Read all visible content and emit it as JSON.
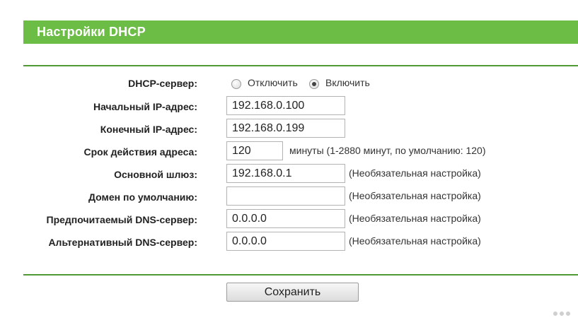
{
  "header": {
    "title": "Настройки DHCP"
  },
  "form": {
    "dhcp_server": {
      "label": "DHCP-сервер:",
      "options": [
        {
          "label": "Отключить",
          "checked": false
        },
        {
          "label": "Включить",
          "checked": true
        }
      ]
    },
    "start_ip": {
      "label": "Начальный IP-адрес:",
      "value": "192.168.0.100"
    },
    "end_ip": {
      "label": "Конечный IP-адрес:",
      "value": "192.168.0.199"
    },
    "lease_time": {
      "label": "Срок действия адреса:",
      "value": "120",
      "hint": "минуты (1-2880 минут, по умолчанию: 120)"
    },
    "gateway": {
      "label": "Основной шлюз:",
      "value": "192.168.0.1",
      "hint": "(Необязательная настройка)"
    },
    "default_domain": {
      "label": "Домен по умолчанию:",
      "value": "",
      "hint": "(Необязательная настройка)"
    },
    "primary_dns": {
      "label": "Предпочитаемый DNS-сервер:",
      "value": "0.0.0.0",
      "hint": "(Необязательная настройка)"
    },
    "secondary_dns": {
      "label": "Альтернативный DNS-сервер:",
      "value": "0.0.0.0",
      "hint": "(Необязательная настройка)"
    }
  },
  "actions": {
    "save_label": "Сохранить"
  },
  "colors": {
    "header_bg": "#6cbd45",
    "divider": "#4f9a33"
  }
}
